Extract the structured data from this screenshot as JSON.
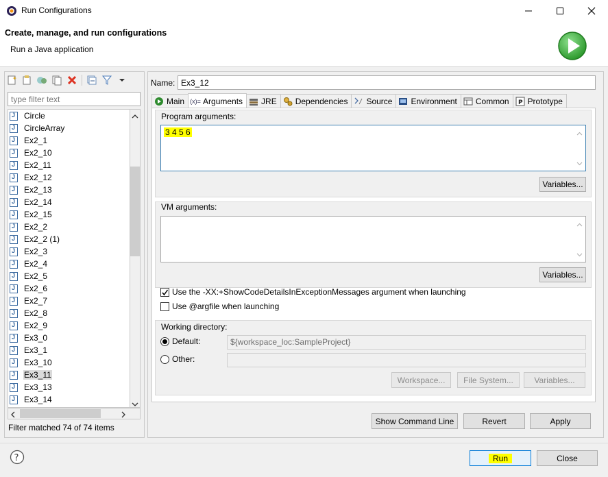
{
  "window": {
    "title": "Run Configurations",
    "controls": [
      "minimize",
      "maximize",
      "close"
    ]
  },
  "header": {
    "title": "Create, manage, and run configurations",
    "subtitle": "Run a Java application"
  },
  "left": {
    "toolbar_icons": [
      "new-config-icon",
      "new-prototype-icon",
      "export-icon",
      "duplicate-icon",
      "delete-icon",
      "collapse-all-icon",
      "filter-icon",
      "dropdown-arrow-icon"
    ],
    "filter_placeholder": "type filter text",
    "items": [
      "Circle",
      "CircleArray",
      "Ex2_1",
      "Ex2_10",
      "Ex2_11",
      "Ex2_12",
      "Ex2_13",
      "Ex2_14",
      "Ex2_15",
      "Ex2_2",
      "Ex2_2 (1)",
      "Ex2_3",
      "Ex2_4",
      "Ex2_5",
      "Ex2_6",
      "Ex2_7",
      "Ex2_8",
      "Ex2_9",
      "Ex3_0",
      "Ex3_1",
      "Ex3_10",
      "Ex3_11",
      "Ex3_13",
      "Ex3_14"
    ],
    "selected_item": "Ex3_11",
    "filter_status": "Filter matched 74 of 74 items"
  },
  "config": {
    "name_label": "Name:",
    "name_value": "Ex3_12",
    "tabs": [
      {
        "label": "Main",
        "icon": "main-tab-icon"
      },
      {
        "label": "Arguments",
        "icon": "arguments-tab-icon"
      },
      {
        "label": "JRE",
        "icon": "jre-tab-icon"
      },
      {
        "label": "Dependencies",
        "icon": "dependencies-tab-icon"
      },
      {
        "label": "Source",
        "icon": "source-tab-icon"
      },
      {
        "label": "Environment",
        "icon": "environment-tab-icon"
      },
      {
        "label": "Common",
        "icon": "common-tab-icon"
      },
      {
        "label": "Prototype",
        "icon": "prototype-tab-icon"
      }
    ],
    "active_tab": "Arguments",
    "program_args_label": "Program arguments:",
    "program_args_value": "3 4 5 6",
    "variables_label": "Variables...",
    "vm_args_label": "VM arguments:",
    "vm_args_value": "",
    "show_code_details_label": "Use the -XX:+ShowCodeDetailsInExceptionMessages argument when launching",
    "show_code_details_checked": true,
    "argfile_label": "Use @argfile when launching",
    "argfile_checked": false,
    "working_dir_label": "Working directory:",
    "default_label": "Default:",
    "default_value": "${workspace_loc:SampleProject}",
    "other_label": "Other:",
    "other_value": "",
    "workspace_btn": "Workspace...",
    "filesystem_btn": "File System...",
    "wd_variables_btn": "Variables..."
  },
  "actions": {
    "show_command_line": "Show Command Line",
    "revert": "Revert",
    "apply": "Apply"
  },
  "footer": {
    "help_icon": "help-icon",
    "run": "Run",
    "close": "Close"
  },
  "colors": {
    "highlight": "#ffff00",
    "run_icon_green": "#3aa83a"
  }
}
